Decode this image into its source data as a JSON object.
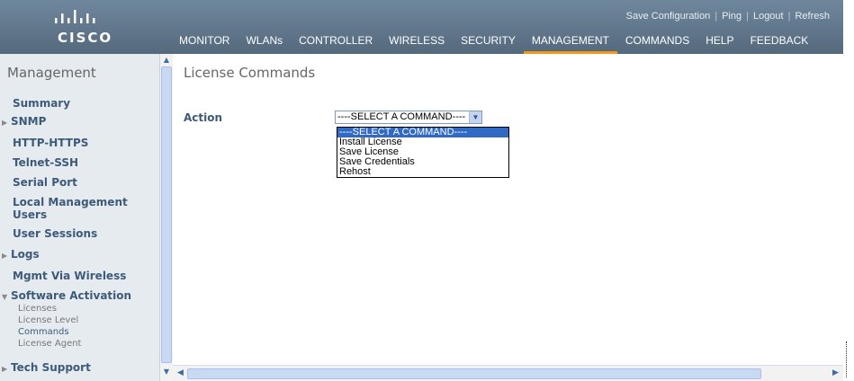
{
  "brand": {
    "logo_text": "CISCO"
  },
  "utility": {
    "save": "Save Configuration",
    "ping": "Ping",
    "logout": "Logout",
    "refresh": "Refresh"
  },
  "nav": {
    "items": [
      "MONITOR",
      "WLANs",
      "CONTROLLER",
      "WIRELESS",
      "SECURITY",
      "MANAGEMENT",
      "COMMANDS",
      "HELP",
      "FEEDBACK"
    ],
    "active": "MANAGEMENT"
  },
  "sidebar": {
    "title": "Management",
    "items": {
      "summary": "Summary",
      "snmp": "SNMP",
      "http": "HTTP-HTTPS",
      "telnet": "Telnet-SSH",
      "serial": "Serial Port",
      "local_mgmt_1": "Local Management",
      "local_mgmt_2": "Users",
      "user_sessions": "User Sessions",
      "logs": "Logs",
      "mgmt_wireless": "Mgmt Via Wireless",
      "software_activation": "Software Activation",
      "tech_support": "Tech Support"
    },
    "sub_items": {
      "licenses": "Licenses",
      "license_level": "License Level",
      "commands": "Commands",
      "license_agent": "License Agent"
    }
  },
  "main": {
    "title": "License Commands",
    "action_label": "Action",
    "select_value": "----SELECT A COMMAND----",
    "options": [
      "----SELECT A COMMAND----",
      "Install License",
      "Save License",
      "Save Credentials",
      "Rehost"
    ]
  }
}
